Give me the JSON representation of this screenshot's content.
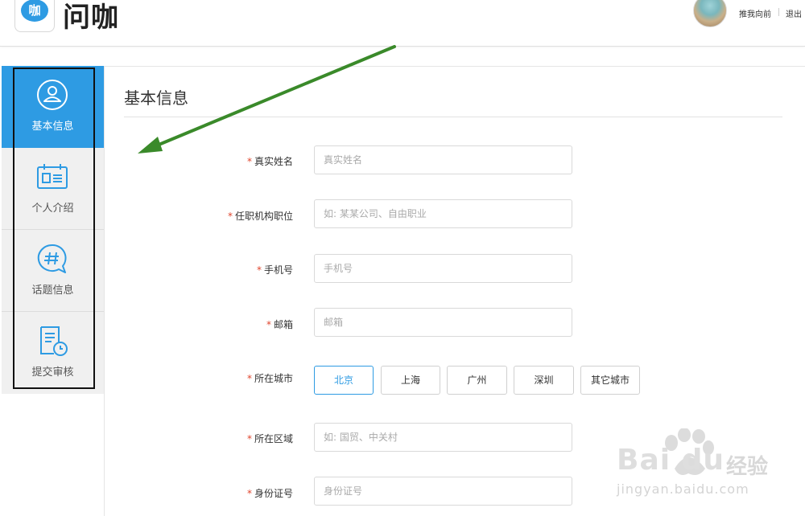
{
  "header": {
    "logo_glyph": "咖",
    "logo_text": "问咖",
    "user_name": "推我向前",
    "logout_label": "退出"
  },
  "sidebar": {
    "items": [
      {
        "label": "基本信息",
        "icon": "user-circle-icon",
        "active": true
      },
      {
        "label": "个人介绍",
        "icon": "id-card-icon",
        "active": false
      },
      {
        "label": "话题信息",
        "icon": "hashtag-bubble-icon",
        "active": false
      },
      {
        "label": "提交审核",
        "icon": "document-clock-icon",
        "active": false
      }
    ]
  },
  "main": {
    "title": "基本信息",
    "form": {
      "required_mark": "*",
      "real_name": {
        "label": "真实姓名",
        "placeholder": "真实姓名",
        "value": ""
      },
      "position": {
        "label": "任职机构职位",
        "placeholder": "如: 某某公司、自由职业",
        "value": ""
      },
      "phone": {
        "label": "手机号",
        "placeholder": "手机号",
        "value": ""
      },
      "email": {
        "label": "邮箱",
        "placeholder": "邮箱",
        "value": ""
      },
      "city": {
        "label": "所在城市",
        "options": [
          "北京",
          "上海",
          "广州",
          "深圳",
          "其它城市"
        ],
        "selected": "北京"
      },
      "district": {
        "label": "所在区域",
        "placeholder": "如: 国贸、中关村",
        "value": ""
      },
      "id_number": {
        "label": "身份证号",
        "placeholder": "身份证号",
        "value": ""
      }
    }
  },
  "watermark": {
    "brand": "Bai du",
    "jingyan": "经验",
    "url": "jingyan.baidu.com"
  },
  "colors": {
    "accent": "#2e9be3",
    "required": "#e0452d",
    "arrow": "#3a8a2a"
  }
}
